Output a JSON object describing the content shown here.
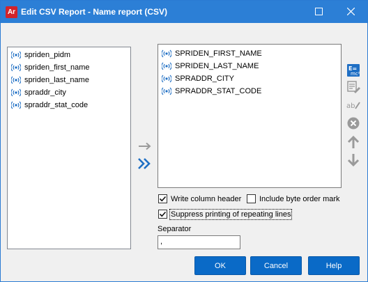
{
  "window": {
    "app_icon_text": "Ar",
    "title": "Edit CSV Report - Name report (CSV)"
  },
  "available_fields": [
    {
      "label": "spriden_pidm"
    },
    {
      "label": "spriden_first_name"
    },
    {
      "label": "spriden_last_name"
    },
    {
      "label": "spraddr_city"
    },
    {
      "label": "spraddr_stat_code"
    }
  ],
  "selected_fields": [
    {
      "label": "SPRIDEN_FIRST_NAME"
    },
    {
      "label": "SPRIDEN_LAST_NAME"
    },
    {
      "label": "SPRADDR_CITY"
    },
    {
      "label": "SPRADDR_STAT_CODE"
    }
  ],
  "options": {
    "write_column_header": {
      "label": "Write column header",
      "checked": true
    },
    "include_byte_order_mark": {
      "label": "Include byte order mark",
      "checked": false
    },
    "suppress_repeating": {
      "label": "Suppress printing of repeating lines",
      "checked": true
    }
  },
  "separator": {
    "label": "Separator",
    "value": ","
  },
  "buttons": {
    "ok": "OK",
    "cancel": "Cancel",
    "help": "Help"
  },
  "colors": {
    "titlebar": "#2c7fd6",
    "accent": "#0a6ac7",
    "icon_blue": "#1f6fc4",
    "icon_gray": "#9a9a9a"
  },
  "icons": {
    "field": "signal-icon",
    "move_right": "arrow-right-icon",
    "move_all": "double-chevron-right-icon",
    "edit_expression": "expression-icon",
    "edit_format": "format-edit-icon",
    "rename": "rename-icon",
    "remove": "remove-icon",
    "up": "arrow-up-icon",
    "down": "arrow-down-icon"
  }
}
